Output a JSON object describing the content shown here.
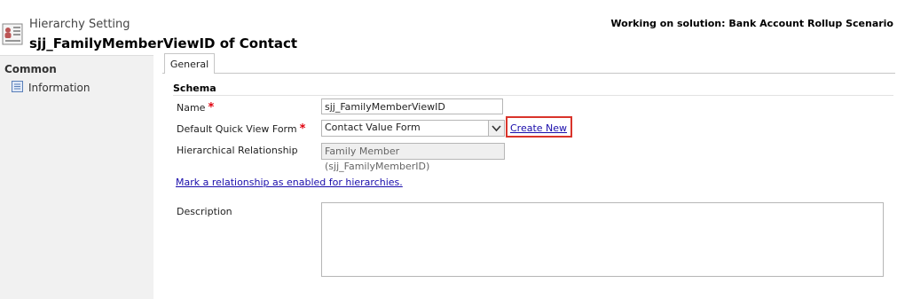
{
  "header": {
    "entity_type": "Hierarchy Setting",
    "record_title": "sjj_FamilyMemberViewID of Contact",
    "solution_label": "Working on solution: Bank Account Rollup Scenario",
    "icon": "hierarchy-setting-icon"
  },
  "sidebar": {
    "group_label": "Common",
    "items": [
      {
        "label": "Information",
        "icon": "form-icon"
      }
    ]
  },
  "tabs": [
    {
      "label": "General"
    }
  ],
  "form": {
    "section_title": "Schema",
    "name_label": "Name",
    "name_value": "sjj_FamilyMemberViewID",
    "quick_view_label": "Default Quick View Form",
    "quick_view_value": "Contact Value Form",
    "create_new_label": "Create New",
    "relationship_label": "Hierarchical Relationship",
    "relationship_value": "Family Member (sjj_FamilyMemberID)",
    "hierarchy_link": "Mark a relationship as enabled for hierarchies.",
    "description_label": "Description",
    "description_value": "",
    "required_marker": "*"
  },
  "colors": {
    "highlight": "#d9342b",
    "link": "#1a0dab",
    "required": "#e0000d",
    "sidebar_bg": "#f1f1f1"
  }
}
